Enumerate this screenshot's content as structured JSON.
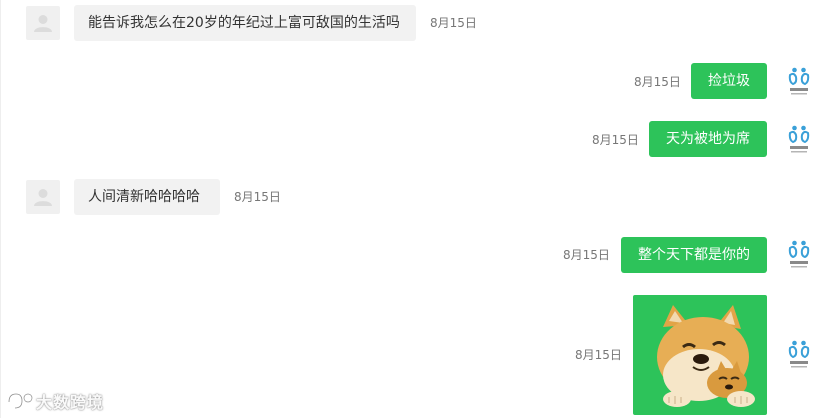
{
  "messages": [
    {
      "side": "in",
      "text": "能告诉我怎么在20岁的年纪过上富可敌国的生活吗",
      "time": "8月15日"
    },
    {
      "side": "out",
      "text": "捡垃圾",
      "time": "8月15日"
    },
    {
      "side": "out",
      "text": "天为被地为席",
      "time": "8月15日"
    },
    {
      "side": "in",
      "text": "人间清新哈哈哈哈",
      "time": "8月15日"
    },
    {
      "side": "out",
      "text": "整个天下都是你的",
      "time": "8月15日"
    },
    {
      "side": "out",
      "type": "sticker",
      "sticker": "doge-hugging-sticker",
      "time": "8月15日"
    }
  ],
  "watermark": {
    "text": "大数跨境"
  },
  "colors": {
    "outgoing_bubble": "#2dc35a",
    "incoming_bubble": "#f2f2f2",
    "timestamp": "#777777",
    "brand": "#3aa0d8"
  },
  "icons": {
    "incoming_avatar": "default-user-avatar-icon",
    "outgoing_avatar": "brand-logo-avatar-icon"
  }
}
